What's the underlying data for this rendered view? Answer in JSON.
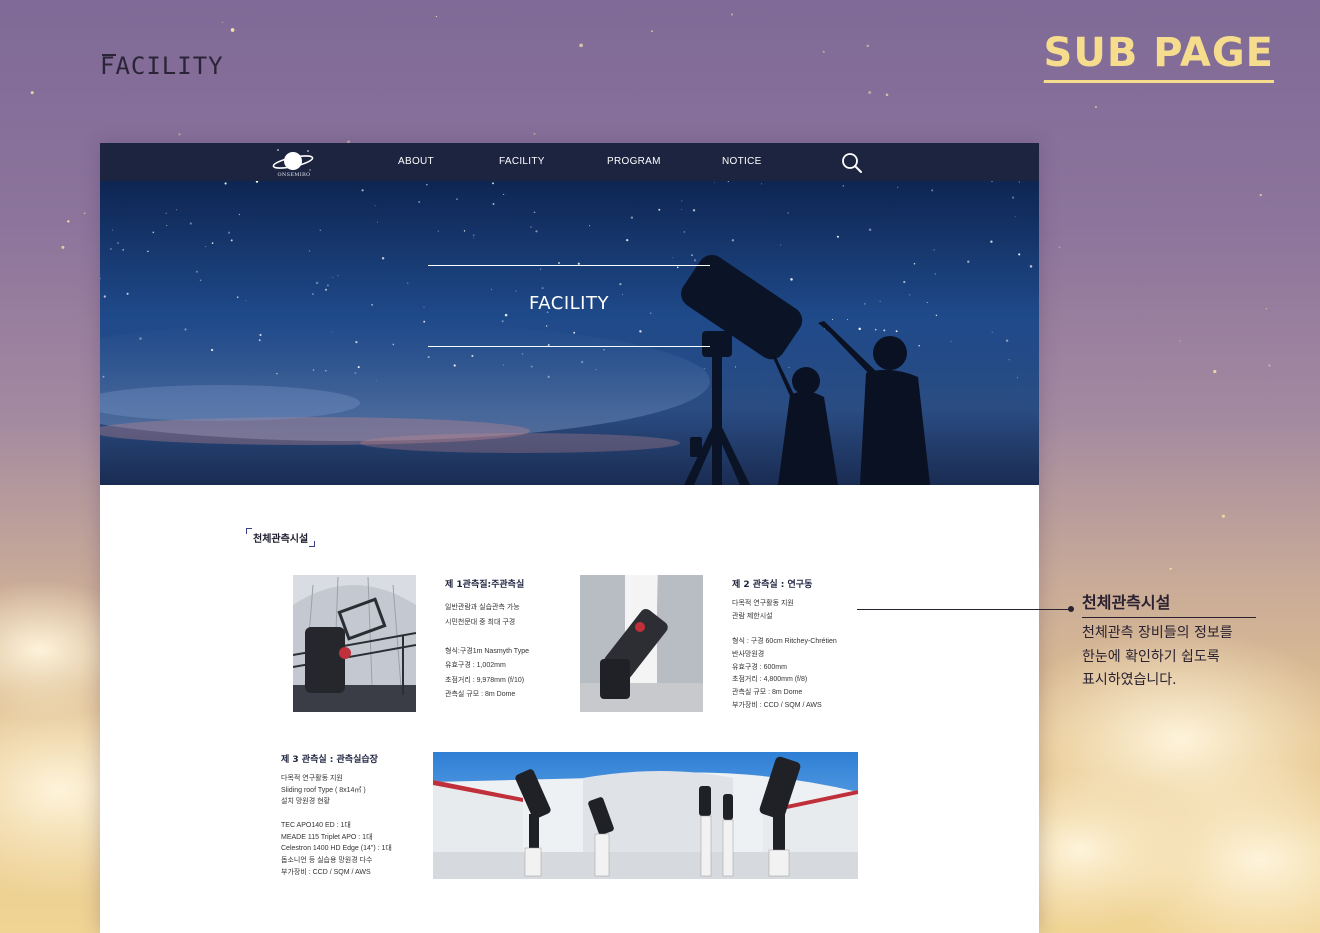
{
  "labels": {
    "facility": "FACILITY",
    "subpage": "SUB PAGE"
  },
  "nav": {
    "logo_text": "ONSEMIRO",
    "items": [
      {
        "label": "ABOUT"
      },
      {
        "label": "FACILITY"
      },
      {
        "label": "PROGRAM"
      },
      {
        "label": "NOTICE"
      }
    ],
    "search_icon": "search-icon"
  },
  "hero": {
    "title": "FACILITY"
  },
  "section": {
    "title": "천체관측시설"
  },
  "facilities": [
    {
      "title": "제 1관측질:주관측실",
      "lines": [
        "일반관람과 실습관측 가능",
        "시민천문대 중 최대 구경",
        "",
        "형식:구경1m Nasmyth Type",
        "유효구경 : 1,002mm",
        "초점거리 : 9,978mm (f/10)",
        "관측실 규모 : 8m Dome"
      ]
    },
    {
      "title": "제 2 관측실 : 연구동",
      "lines": [
        "다목적 연구활동 지원",
        "관람 제한시설",
        "",
        "형식 : 구경 60cm Ritchey-Chrétien",
        "반사망원경",
        "유효구경 : 600mm",
        "초점거리 : 4,800mm (f/8)",
        "관측실 규모 : 8m Dome",
        "부가장비 : CCD / SQM / AWS"
      ]
    },
    {
      "title": "제 3 관측실 : 관측실습장",
      "lines": [
        "다목적 연구활동 지원",
        "Sliding roof Type ( 8x14㎡ )",
        "설치 망원경 현황",
        "",
        "TEC APO140 ED : 1대",
        "MEADE 115 Triplet APO : 1대",
        "Celestron 1400 HD Edge (14\") : 1대",
        "돕소니언 등 실습용 망원경 다수",
        "부가장비 : CCD / SQM / AWS"
      ]
    }
  ],
  "annotation": {
    "title": "천체관측시설",
    "lines": [
      "천체관측 장비들의 정보를",
      "한눈에 확인하기 쉽도록",
      "표시하였습니다."
    ]
  },
  "colors": {
    "nav_bg": "#1c2440",
    "subpage_accent": "#f6dc8d",
    "hero_sky": "#1d3d78"
  }
}
